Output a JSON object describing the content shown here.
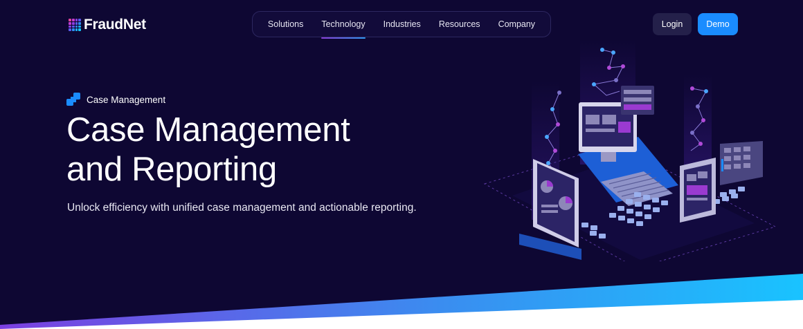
{
  "brand": {
    "name": "FraudNet"
  },
  "nav": {
    "items": [
      {
        "label": "Solutions"
      },
      {
        "label": "Technology",
        "active": true
      },
      {
        "label": "Industries"
      },
      {
        "label": "Resources"
      },
      {
        "label": "Company"
      }
    ]
  },
  "header": {
    "login_label": "Login",
    "demo_label": "Demo"
  },
  "hero": {
    "eyebrow": "Case Management",
    "title_line1": "Case Management",
    "title_line2": "and Reporting",
    "subtitle": "Unlock efficiency with unified case management and actionable reporting."
  },
  "colors": {
    "background": "#0e0733",
    "accent_blue": "#1a8cff",
    "accent_purple": "#8b3dd8",
    "wedge_gradient": [
      "#7b3fe0",
      "#3a8df0",
      "#19c3ff"
    ]
  }
}
